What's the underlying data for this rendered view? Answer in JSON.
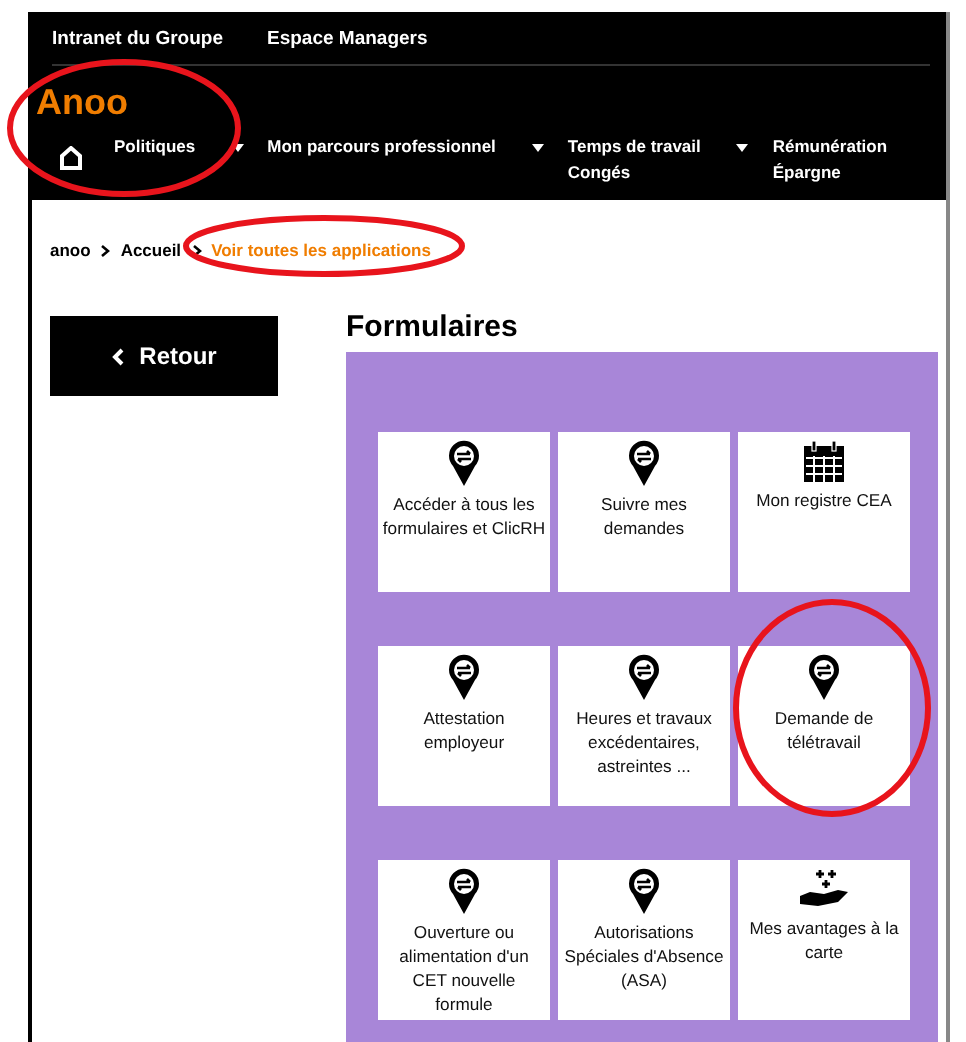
{
  "top_links": [
    "Intranet du Groupe",
    "Espace Managers"
  ],
  "logo": "Anoo",
  "nav": [
    {
      "label": "Politiques",
      "caret": true
    },
    {
      "label": "Mon parcours professionnel",
      "caret": true
    },
    {
      "label": "Temps de travail\nCongés",
      "caret": true
    },
    {
      "label": "Rémunération\nÉpargne",
      "caret": false
    }
  ],
  "breadcrumb": [
    {
      "label": "anoo",
      "current": false
    },
    {
      "label": "Accueil",
      "current": false
    },
    {
      "label": "Voir toutes les applications",
      "current": true
    }
  ],
  "back_button": "Retour",
  "section_title": "Formulaires",
  "tiles": [
    {
      "kind": "pin",
      "label": "Accéder à tous les formulaires et ClicRH"
    },
    {
      "kind": "pin",
      "label": "Suivre mes demandes"
    },
    {
      "kind": "calendar",
      "label": "Mon registre CEA"
    },
    {
      "kind": "pin",
      "label": "Attestation employeur"
    },
    {
      "kind": "pin",
      "label": "Heures et travaux excédentaires, astreintes ..."
    },
    {
      "kind": "pin",
      "label": "Demande de télétravail"
    },
    {
      "kind": "pin",
      "label": "Ouverture ou alimentation d'un CET nouvelle formule"
    },
    {
      "kind": "pin",
      "label": "Autorisations Spéciales d'Absence (ASA)"
    },
    {
      "kind": "hand",
      "label": "Mes avantages à la carte"
    }
  ]
}
